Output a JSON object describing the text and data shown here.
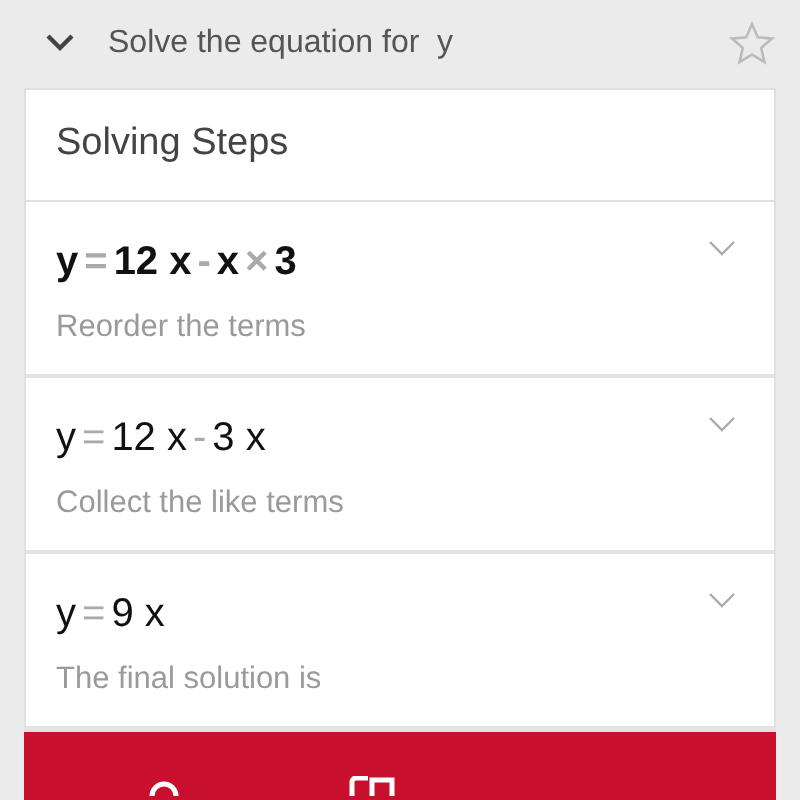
{
  "header": {
    "title": "Solve the equation for  y",
    "expanded": true,
    "starred": false
  },
  "section_title": "Solving Steps",
  "steps": [
    {
      "bold": true,
      "equation": [
        {
          "kind": "term",
          "text": "y"
        },
        {
          "kind": "operator",
          "text": "="
        },
        {
          "kind": "term",
          "text": "12 x"
        },
        {
          "kind": "operator",
          "text": "-"
        },
        {
          "kind": "term",
          "text": "x"
        },
        {
          "kind": "operator",
          "text": "×"
        },
        {
          "kind": "term",
          "text": "3"
        }
      ],
      "description": "Reorder the terms"
    },
    {
      "bold": false,
      "equation": [
        {
          "kind": "term",
          "text": "y"
        },
        {
          "kind": "operator",
          "text": "="
        },
        {
          "kind": "term",
          "text": "12 x"
        },
        {
          "kind": "operator",
          "text": "-"
        },
        {
          "kind": "term",
          "text": "3 x"
        }
      ],
      "description": "Collect the like terms"
    },
    {
      "bold": false,
      "equation": [
        {
          "kind": "term",
          "text": "y"
        },
        {
          "kind": "operator",
          "text": "="
        },
        {
          "kind": "term",
          "text": "9 x"
        }
      ],
      "description": "The final solution is"
    }
  ]
}
